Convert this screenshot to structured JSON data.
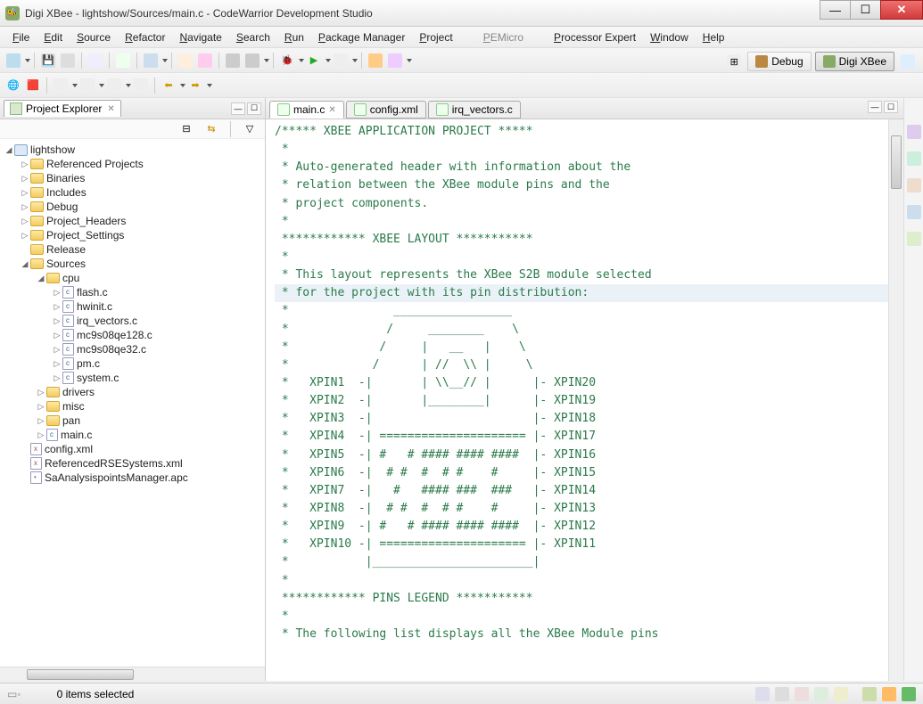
{
  "window": {
    "title": "Digi XBee - lightshow/Sources/main.c - CodeWarrior Development Studio"
  },
  "menu": [
    "File",
    "Edit",
    "Source",
    "Refactor",
    "Navigate",
    "Search",
    "Run",
    "Package Manager",
    "Project",
    "PEMicro",
    "Processor Expert",
    "Window",
    "Help"
  ],
  "perspectives": {
    "debug": "Debug",
    "active": "Digi XBee"
  },
  "project_explorer": {
    "title": "Project Explorer",
    "root": "lightshow",
    "nodes": [
      {
        "label": "Referenced Projects",
        "icon": "folder",
        "level": 1,
        "expand": "▷"
      },
      {
        "label": "Binaries",
        "icon": "folder",
        "level": 1,
        "expand": "▷"
      },
      {
        "label": "Includes",
        "icon": "folder",
        "level": 1,
        "expand": "▷"
      },
      {
        "label": "Debug",
        "icon": "folder",
        "level": 1,
        "expand": "▷"
      },
      {
        "label": "Project_Headers",
        "icon": "folder",
        "level": 1,
        "expand": "▷"
      },
      {
        "label": "Project_Settings",
        "icon": "folder",
        "level": 1,
        "expand": "▷"
      },
      {
        "label": "Release",
        "icon": "folder",
        "level": 1,
        "expand": ""
      },
      {
        "label": "Sources",
        "icon": "folder",
        "level": 1,
        "expand": "◢"
      },
      {
        "label": "cpu",
        "icon": "folder",
        "level": 2,
        "expand": "◢"
      },
      {
        "label": "flash.c",
        "icon": "file",
        "level": 3,
        "expand": "▷"
      },
      {
        "label": "hwinit.c",
        "icon": "file",
        "level": 3,
        "expand": "▷"
      },
      {
        "label": "irq_vectors.c",
        "icon": "file",
        "level": 3,
        "expand": "▷"
      },
      {
        "label": "mc9s08qe128.c",
        "icon": "file",
        "level": 3,
        "expand": "▷"
      },
      {
        "label": "mc9s08qe32.c",
        "icon": "file",
        "level": 3,
        "expand": "▷"
      },
      {
        "label": "pm.c",
        "icon": "file",
        "level": 3,
        "expand": "▷"
      },
      {
        "label": "system.c",
        "icon": "file",
        "level": 3,
        "expand": "▷"
      },
      {
        "label": "drivers",
        "icon": "folder",
        "level": 2,
        "expand": "▷"
      },
      {
        "label": "misc",
        "icon": "folder",
        "level": 2,
        "expand": "▷"
      },
      {
        "label": "pan",
        "icon": "folder",
        "level": 2,
        "expand": "▷"
      },
      {
        "label": "main.c",
        "icon": "file",
        "level": 2,
        "expand": "▷"
      },
      {
        "label": "config.xml",
        "icon": "xml",
        "level": 1,
        "expand": ""
      },
      {
        "label": "ReferencedRSESystems.xml",
        "icon": "xml",
        "level": 1,
        "expand": ""
      },
      {
        "label": "SaAnalysispointsManager.apc",
        "icon": "apc",
        "level": 1,
        "expand": ""
      }
    ]
  },
  "editor_tabs": [
    {
      "label": "main.c",
      "active": true
    },
    {
      "label": "config.xml",
      "active": false
    },
    {
      "label": "irq_vectors.c",
      "active": false
    }
  ],
  "code_lines": [
    "/***** XBEE APPLICATION PROJECT *****",
    " *",
    " * Auto-generated header with information about the",
    " * relation between the XBee module pins and the",
    " * project components.",
    " *",
    " ************ XBEE LAYOUT ***********",
    " *",
    " * This layout represents the XBee S2B module selected",
    " * for the project with its pin distribution:",
    " *               _________________",
    " *              /     ________    \\",
    " *             /     |   __   |    \\",
    " *            /      | //  \\\\ |     \\",
    " *   XPIN1  -|       | \\\\__// |      |- XPIN20",
    " *   XPIN2  -|       |________|      |- XPIN19",
    " *   XPIN3  -|                       |- XPIN18",
    " *   XPIN4  -| ===================== |- XPIN17",
    " *   XPIN5  -| #   # #### #### ####  |- XPIN16",
    " *   XPIN6  -|  # #  #  # #    #     |- XPIN15",
    " *   XPIN7  -|   #   #### ###  ###   |- XPIN14",
    " *   XPIN8  -|  # #  #  # #    #     |- XPIN13",
    " *   XPIN9  -| #   # #### #### ####  |- XPIN12",
    " *   XPIN10 -| ===================== |- XPIN11",
    " *           |_______________________|",
    " *",
    " ************ PINS LEGEND ***********",
    " *",
    " * The following list displays all the XBee Module pins"
  ],
  "highlight_line_index": 9,
  "status": {
    "text": "0 items selected"
  }
}
